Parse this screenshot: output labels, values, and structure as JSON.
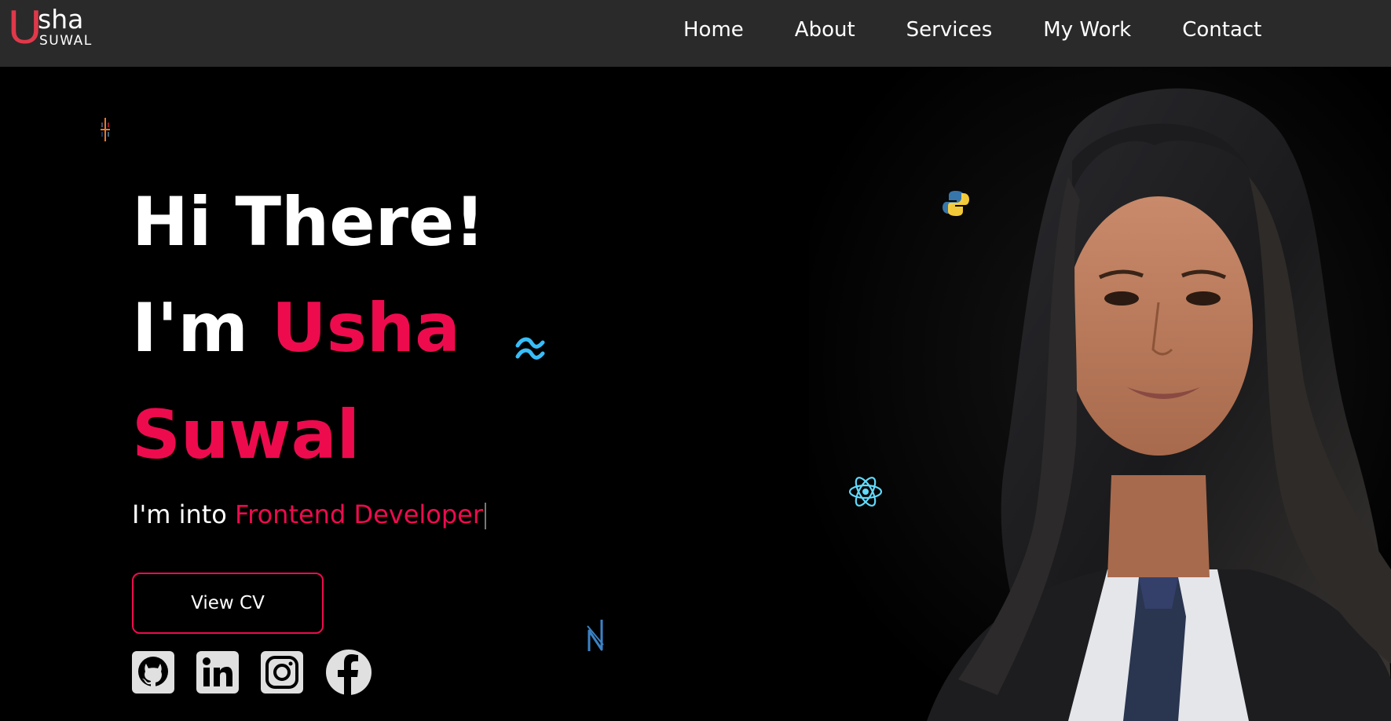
{
  "logo": {
    "letter": "U",
    "first": "sha",
    "last": "SUWAL"
  },
  "nav": {
    "items": [
      {
        "label": "Home"
      },
      {
        "label": "About"
      },
      {
        "label": "Services"
      },
      {
        "label": "My Work"
      },
      {
        "label": "Contact"
      }
    ]
  },
  "hero": {
    "greeting": "Hi There!",
    "im": "I'm ",
    "first_name": "Usha",
    "last_name": "Suwal",
    "intro_prefix": "I'm into ",
    "role": "Frontend Developer",
    "cv_button": "View CV"
  },
  "socials": [
    "github-icon",
    "linkedin-icon",
    "instagram-icon",
    "facebook-icon"
  ],
  "floating_icons": [
    "tableau-icon",
    "python-icon",
    "tailwind-icon",
    "react-icon",
    "nextjs-icon"
  ],
  "colors": {
    "accent": "#ed0b4e",
    "nav_bg": "#2a2a2a",
    "logo_u": "#e0394a",
    "page_bg": "#000000"
  }
}
